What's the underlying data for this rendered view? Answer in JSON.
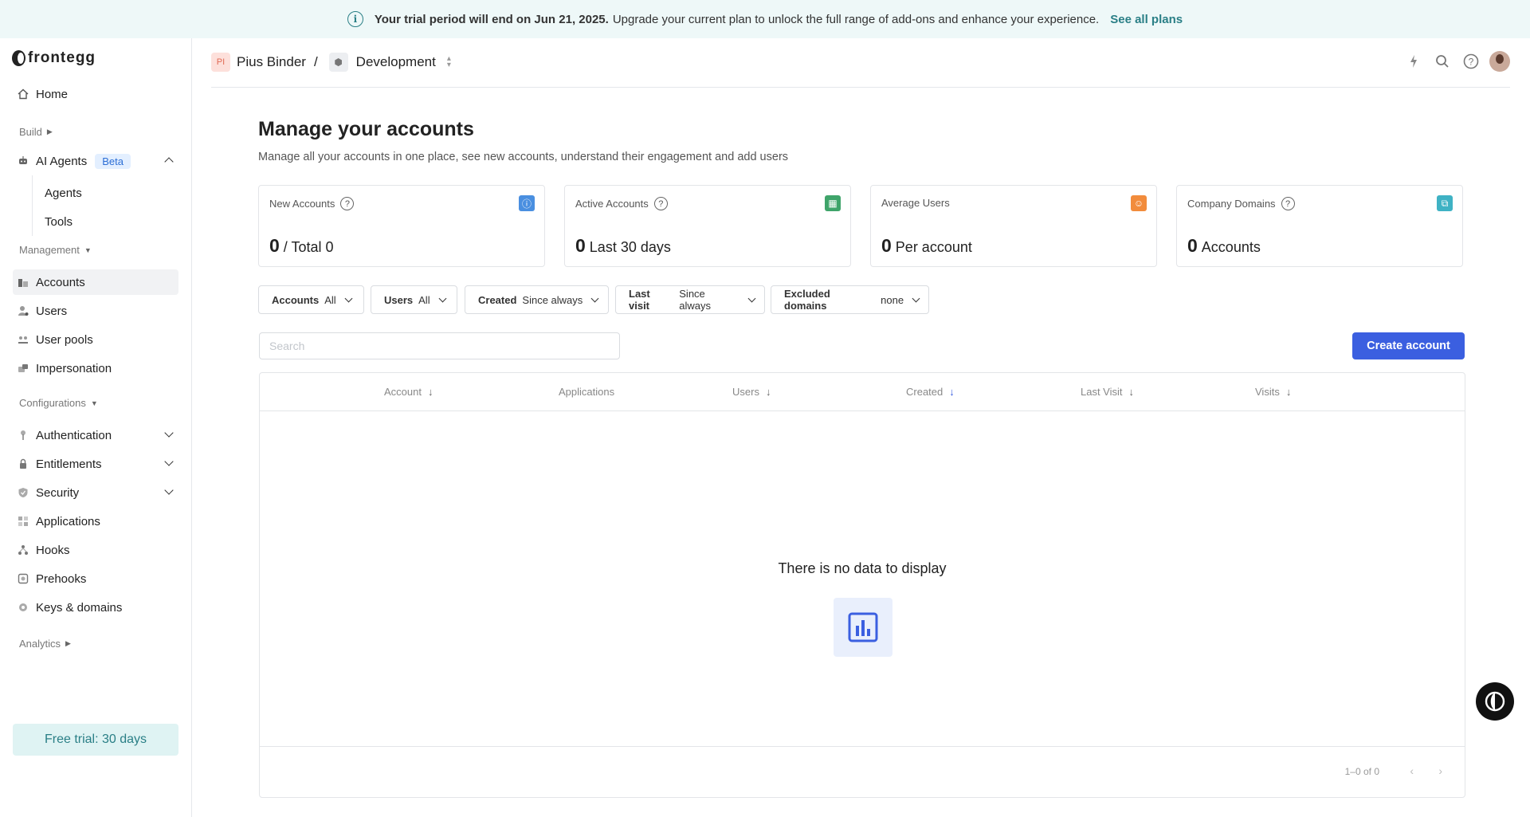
{
  "banner": {
    "bold_text": "Your trial period will end on Jun 21, 2025.",
    "text": "Upgrade your current plan to unlock the full range of add-ons and enhance your experience.",
    "link": "See all plans"
  },
  "sidebar": {
    "logo": "frontegg",
    "home": "Home",
    "build_label": "Build",
    "ai_agents": {
      "label": "AI Agents",
      "badge": "Beta"
    },
    "ai_children": [
      "Agents",
      "Tools"
    ],
    "management_label": "Management",
    "management_items": [
      "Accounts",
      "Users",
      "User pools",
      "Impersonation"
    ],
    "configurations_label": "Configurations",
    "config_items": [
      "Authentication",
      "Entitlements",
      "Security",
      "Applications",
      "Hooks",
      "Prehooks",
      "Keys & domains"
    ],
    "analytics_label": "Analytics",
    "trial_button": "Free trial: 30 days"
  },
  "topbar": {
    "initials": "PI",
    "workspace": "Pius Binder",
    "separator": "/",
    "environment": "Development"
  },
  "main": {
    "title": "Manage your accounts",
    "subtitle": "Manage all your accounts in one place, see new accounts, understand their engagement and add users"
  },
  "cards": [
    {
      "label": "New Accounts",
      "value": "0",
      "suffix": "/ Total 0",
      "icon": "info-icon",
      "color": "#4a8fe0"
    },
    {
      "label": "Active Accounts",
      "value": "0",
      "suffix": "Last 30 days",
      "icon": "table-icon",
      "color": "#3fa46a"
    },
    {
      "label": "Average Users",
      "value": "0",
      "suffix": "Per account",
      "icon": "user-group-icon",
      "color": "#f28c3c"
    },
    {
      "label": "Company Domains",
      "value": "0",
      "suffix": "Accounts",
      "icon": "domains-icon",
      "color": "#3fb2c4"
    }
  ],
  "filters": [
    {
      "label": "Accounts",
      "value": "All"
    },
    {
      "label": "Users",
      "value": "All"
    },
    {
      "label": "Created",
      "value": "Since always"
    },
    {
      "label": "Last visit",
      "value": "Since always"
    },
    {
      "label": "Excluded domains",
      "value": "none"
    }
  ],
  "search": {
    "placeholder": "Search"
  },
  "create_button": "Create account",
  "table": {
    "columns": [
      "Account",
      "Applications",
      "Users",
      "Created",
      "Last Visit",
      "Visits"
    ],
    "empty_text": "There is no data to display",
    "range": "1–0 of 0"
  },
  "colors": {
    "primary": "#3b5fe0",
    "teal": "#2a7f86",
    "banner_bg": "#eef8f8"
  }
}
